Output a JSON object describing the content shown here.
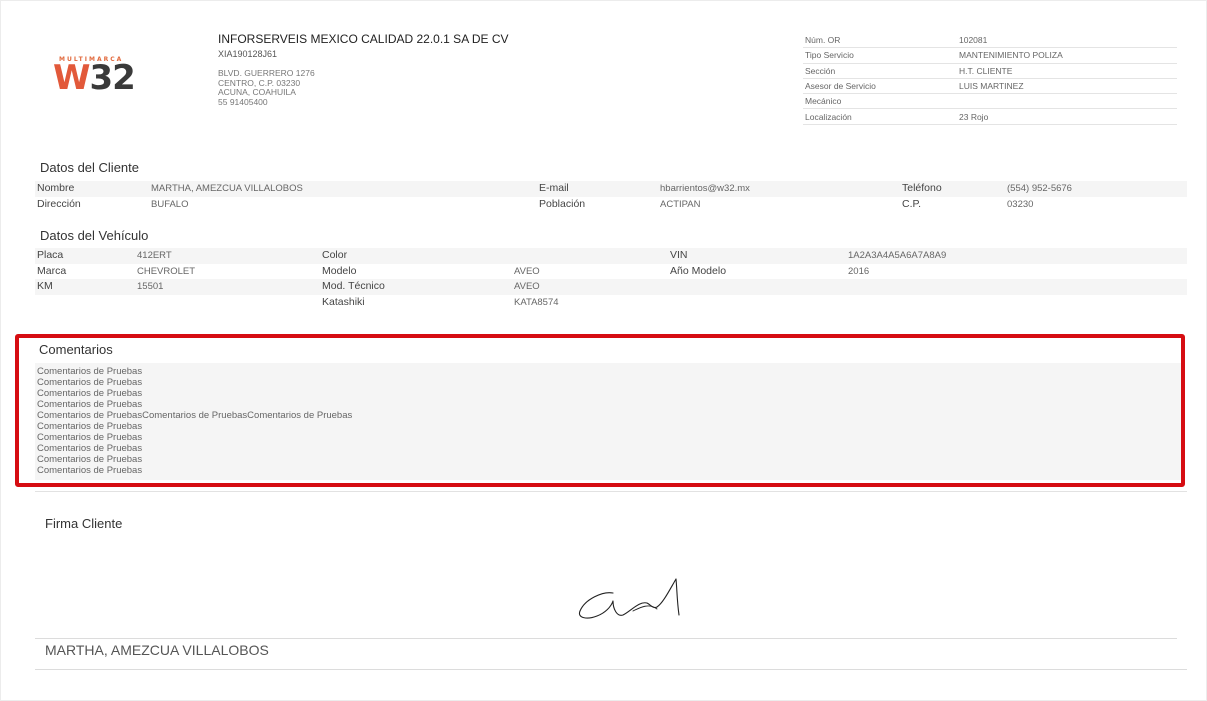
{
  "logo": {
    "tagline": "MULTIMARCA",
    "brand_w": "W",
    "brand_n": "32"
  },
  "company": {
    "name": "INFORSERVEIS MEXICO CALIDAD 22.0.1 SA DE CV",
    "rfc": "XIA190128J61",
    "address": [
      "BLVD. GUERRERO 1276",
      "CENTRO, C.P. 03230",
      "ACUNA, COAHUILA",
      "55 91405400"
    ]
  },
  "order": [
    {
      "label": "Núm. OR",
      "value": "102081"
    },
    {
      "label": "Tipo Servicio",
      "value": "MANTENIMIENTO POLIZA"
    },
    {
      "label": "Sección",
      "value": "H.T. CLIENTE"
    },
    {
      "label": "Asesor de Servicio",
      "value": "LUIS MARTINEZ"
    },
    {
      "label": "Mecánico",
      "value": ""
    },
    {
      "label": "Localización",
      "value": "23 Rojo"
    }
  ],
  "client": {
    "title": "Datos del Cliente",
    "nombre_label": "Nombre",
    "nombre": "MARTHA, AMEZCUA VILLALOBOS",
    "email_label": "E-mail",
    "email": "hbarrientos@w32.mx",
    "telefono_label": "Teléfono",
    "telefono": "(554) 952-5676",
    "direccion_label": "Dirección",
    "direccion": "BUFALO",
    "poblacion_label": "Población",
    "poblacion": "ACTIPAN",
    "cp_label": "C.P.",
    "cp": "03230"
  },
  "vehicle": {
    "title": "Datos del Vehículo",
    "placa_label": "Placa",
    "placa": "412ERT",
    "color_label": "Color",
    "color": "",
    "vin_label": "VIN",
    "vin": "1A2A3A4A5A6A7A8A9",
    "marca_label": "Marca",
    "marca": "CHEVROLET",
    "modelo_label": "Modelo",
    "modelo": "AVEO",
    "anio_label": "Año Modelo",
    "anio": "2016",
    "km_label": "KM",
    "km": "15501",
    "modtec_label": "Mod. Técnico",
    "modtec": "AVEO",
    "katashiki_label": "Katashiki",
    "katashiki": "KATA8574"
  },
  "comments": {
    "title": "Comentarios",
    "lines": [
      "Comentarios de Pruebas",
      "Comentarios de Pruebas",
      "Comentarios de Pruebas",
      "Comentarios de Pruebas",
      "Comentarios de PruebasComentarios de PruebasComentarios de Pruebas",
      "Comentarios de Pruebas",
      "Comentarios de Pruebas",
      "Comentarios de Pruebas",
      "Comentarios de Pruebas",
      "Comentarios de Pruebas"
    ]
  },
  "signature": {
    "title": "Firma Cliente",
    "name": "MARTHA, AMEZCUA VILLALOBOS"
  },
  "colors": {
    "brand_orange": "#e2593a",
    "highlight_red": "#d60d12"
  }
}
